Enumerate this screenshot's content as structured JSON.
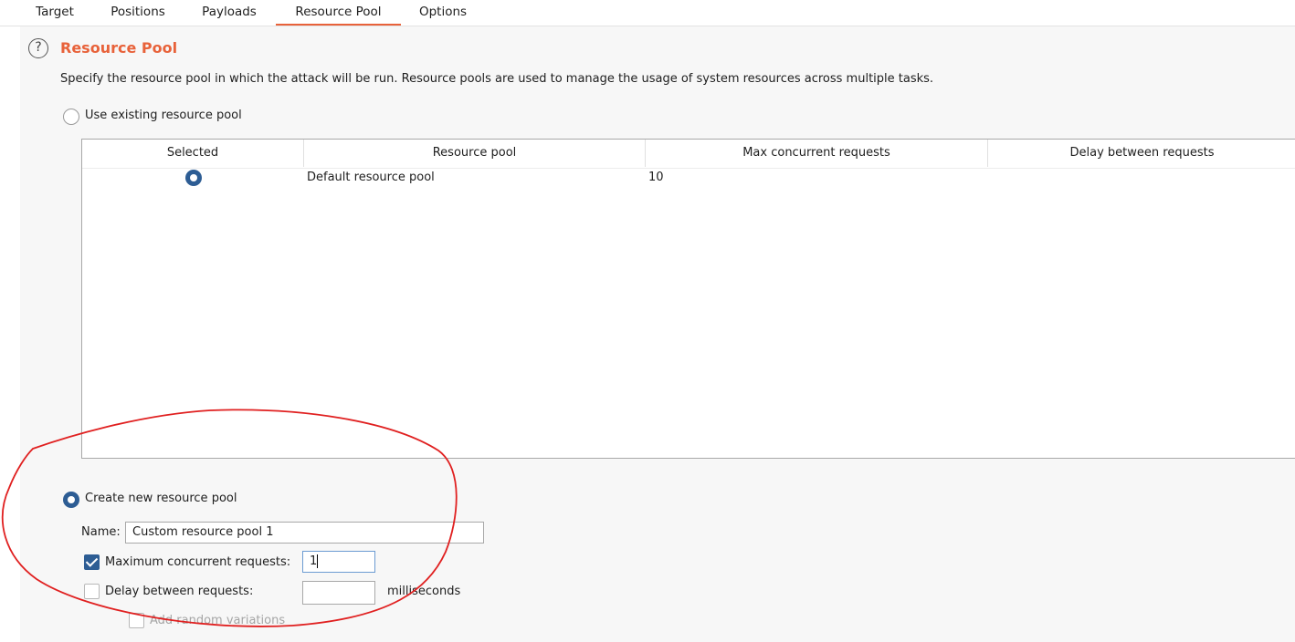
{
  "tabs": [
    {
      "label": "Target"
    },
    {
      "label": "Positions"
    },
    {
      "label": "Payloads"
    },
    {
      "label": "Resource Pool"
    },
    {
      "label": "Options"
    }
  ],
  "active_tab": "Resource Pool",
  "section": {
    "title": "Resource Pool",
    "description": "Specify the resource pool in which the attack will be run. Resource pools are used to manage the usage of system resources across multiple tasks."
  },
  "existing_pool": {
    "radio_label": "Use existing resource pool",
    "selected": false,
    "columns": [
      "Selected",
      "Resource pool",
      "Max concurrent requests",
      "Delay between requests"
    ],
    "rows": [
      {
        "selected": true,
        "resource_pool": "Default resource pool",
        "max_concurrent": "10",
        "delay": ""
      }
    ]
  },
  "new_pool": {
    "radio_label": "Create new resource pool",
    "selected": true,
    "name_label": "Name:",
    "name_value": "Custom resource pool 1",
    "max_concurrent_label": "Maximum concurrent requests:",
    "max_concurrent_checked": true,
    "max_concurrent_value": "1",
    "delay_label": "Delay between requests:",
    "delay_checked": false,
    "delay_value": "",
    "delay_unit": "milliseconds",
    "random_label": "Add random variations",
    "random_checked": false
  },
  "colors": {
    "accent": "#e8623a",
    "selected_control": "#2d5d94",
    "annotation": "#e02020"
  }
}
